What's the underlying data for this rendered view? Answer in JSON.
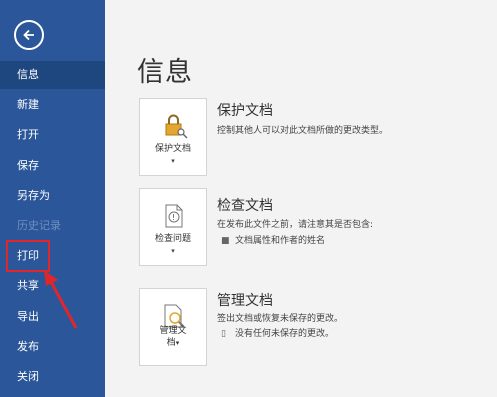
{
  "sidebar": {
    "items": [
      {
        "label": "信息"
      },
      {
        "label": "新建"
      },
      {
        "label": "打开"
      },
      {
        "label": "保存"
      },
      {
        "label": "另存为"
      },
      {
        "label": "历史记录"
      },
      {
        "label": "打印"
      },
      {
        "label": "共享"
      },
      {
        "label": "导出"
      },
      {
        "label": "发布"
      },
      {
        "label": "关闭"
      }
    ]
  },
  "main": {
    "title": "信息",
    "sections": [
      {
        "card_label_1": "保护文档",
        "title": "保护文档",
        "desc": "控制其他人可以对此文档所做的更改类型。"
      },
      {
        "card_label_1": "检查问题",
        "title": "检查文档",
        "desc": "在发布此文件之前，请注意其是否包含:",
        "bullets": [
          "文档属性和作者的姓名"
        ]
      },
      {
        "card_label_1": "管理文",
        "card_label_2": "档",
        "title": "管理文档",
        "desc": "签出文档或恢复未保存的更改。",
        "bullets": [
          "没有任何未保存的更改。"
        ]
      }
    ]
  },
  "colors": {
    "sidebar": "#2b579a",
    "active": "#1e4780",
    "highlight": "#e0262a"
  }
}
